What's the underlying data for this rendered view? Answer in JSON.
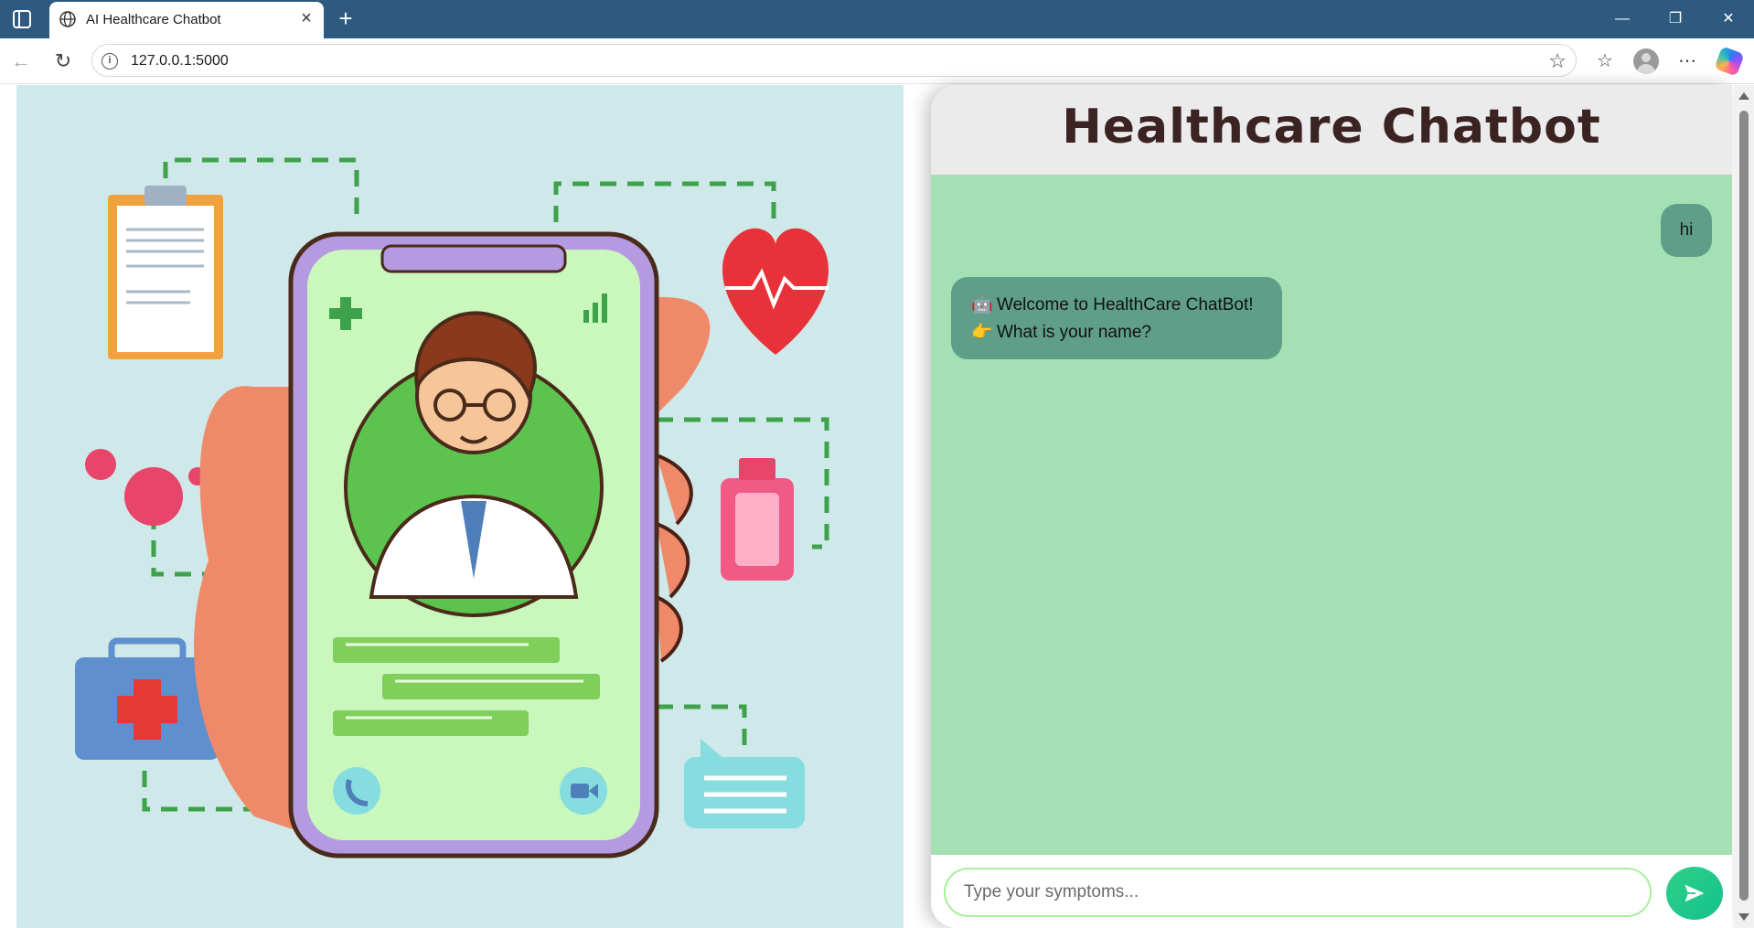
{
  "browser": {
    "tab_title": "AI Healthcare Chatbot",
    "new_tab_label": "+",
    "url": "127.0.0.1:5000"
  },
  "chat": {
    "title": "Healthcare Chatbot",
    "messages": [
      {
        "role": "user",
        "text": "hi"
      },
      {
        "role": "bot",
        "lines": [
          {
            "emoji": "🤖",
            "text": "Welcome to HealthCare ChatBot!"
          },
          {
            "emoji": "👉",
            "text": "What is your name?"
          }
        ]
      }
    ],
    "input_placeholder": "Type your symptoms..."
  },
  "colors": {
    "tabbar": "#2d5a7e",
    "chat_body": "#a4e0b4",
    "bubble": "#5f9e88",
    "title_text": "#3b2323",
    "send_button": "#2fd189",
    "illustration_bg": "#cfe8ea"
  }
}
